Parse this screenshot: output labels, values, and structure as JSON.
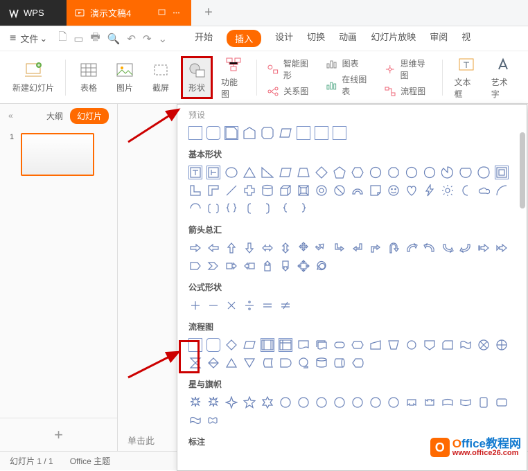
{
  "title_bar": {
    "logo": "WPS",
    "doc_tab": "演示文稿4",
    "new_tab_icon": "plus"
  },
  "quick_access": {
    "file_label": "文件",
    "icons": [
      "save",
      "print",
      "undo",
      "redo",
      "more"
    ]
  },
  "main_tabs": {
    "items": [
      "开始",
      "插入",
      "设计",
      "切换",
      "动画",
      "幻灯片放映",
      "审阅",
      "视"
    ],
    "active_index": 1
  },
  "ribbon": {
    "new_slide": "新建幻灯片",
    "table": "表格",
    "picture": "图片",
    "screenshot": "截屏",
    "shapes": "形状",
    "diagram": "功能图",
    "smart_art": "智能图形",
    "chart": "图表",
    "relation": "关系图",
    "online_chart": "在线图表",
    "mindmap": "思维导图",
    "flowchart": "流程图",
    "textbox": "文本框",
    "wordart": "艺术字"
  },
  "side_panel": {
    "collapse": "«",
    "outline_tab": "大纲",
    "slides_tab": "幻灯片",
    "slide_number": "1",
    "add_icon": "+"
  },
  "note_prompt": "单击此",
  "shapes_panel": {
    "sections": {
      "preset": "预设",
      "basic": "基本形状",
      "arrows": "箭头总汇",
      "formula": "公式形状",
      "flowchart": "流程图",
      "stars": "星与旗帜",
      "callouts": "标注"
    }
  },
  "status_bar": {
    "slide_counter": "幻灯片 1 / 1",
    "theme": "Office 主题"
  },
  "watermark": {
    "brand_o": "O",
    "brand_rest": "ffice教程网",
    "url": "www.office26.com",
    "icon_letter": "O"
  }
}
